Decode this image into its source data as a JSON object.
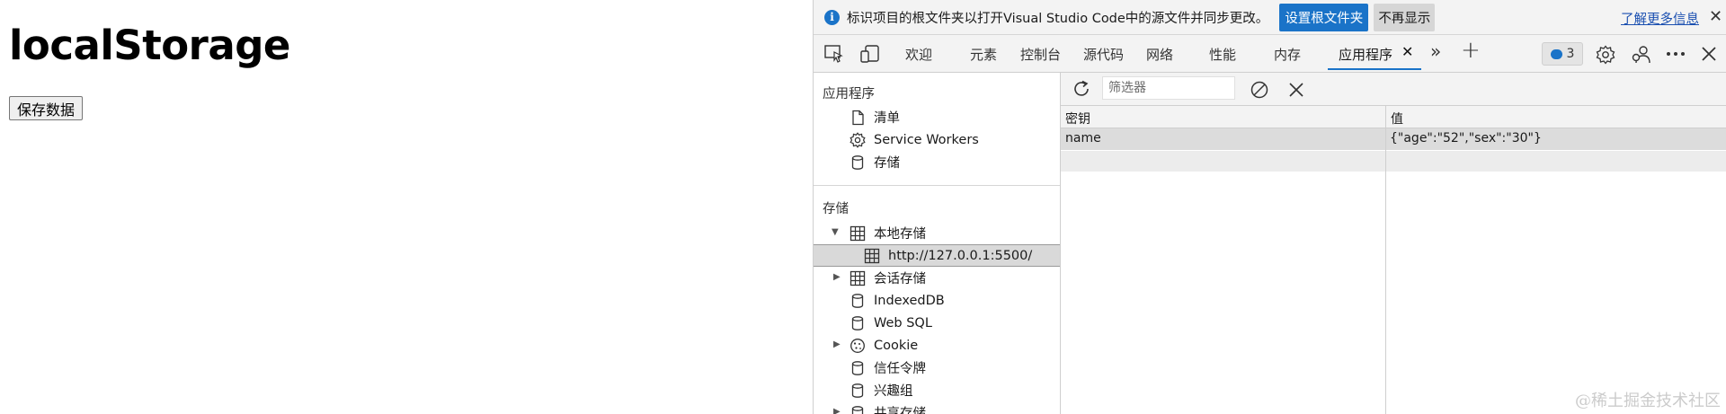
{
  "page": {
    "heading": "localStorage",
    "save_button": "保存数据"
  },
  "infobar": {
    "message": "标识项目的根文件夹以打开Visual Studio Code中的源文件并同步更改。",
    "set_root_button": "设置根文件夹",
    "dont_show_button": "不再显示",
    "learn_more_link": "了解更多信息",
    "close": "✕"
  },
  "tabs": {
    "items": [
      "欢迎",
      "元素",
      "控制台",
      "源代码",
      "网络",
      "性能",
      "内存",
      "应用程序"
    ],
    "active": "应用程序",
    "close": "✕",
    "more": "»",
    "add": "+",
    "message_count": "3"
  },
  "sidebar": {
    "app_section": "应用程序",
    "app_items": [
      "清单",
      "Service Workers",
      "存储"
    ],
    "storage_section": "存储",
    "storage_items": {
      "local_storage": "本地存储",
      "local_origin": "http://127.0.0.1:5500/",
      "session_storage": "会话存储",
      "indexeddb": "IndexedDB",
      "websql": "Web SQL",
      "cookie": "Cookie",
      "trust_tokens": "信任令牌",
      "interest_groups": "兴趣组",
      "shared_storage": "共享存储"
    }
  },
  "main": {
    "filter_placeholder": "筛选器",
    "columns": [
      "密钥",
      "值"
    ],
    "rows": [
      {
        "key": "name",
        "value": "{\"age\":\"52\",\"sex\":\"30\"}"
      }
    ]
  },
  "watermark": "@稀土掘金技术社区",
  "colors": {
    "accent": "#1a73c8",
    "panel_bg": "#f3f3f3",
    "selected_row": "#dcdcdc"
  }
}
